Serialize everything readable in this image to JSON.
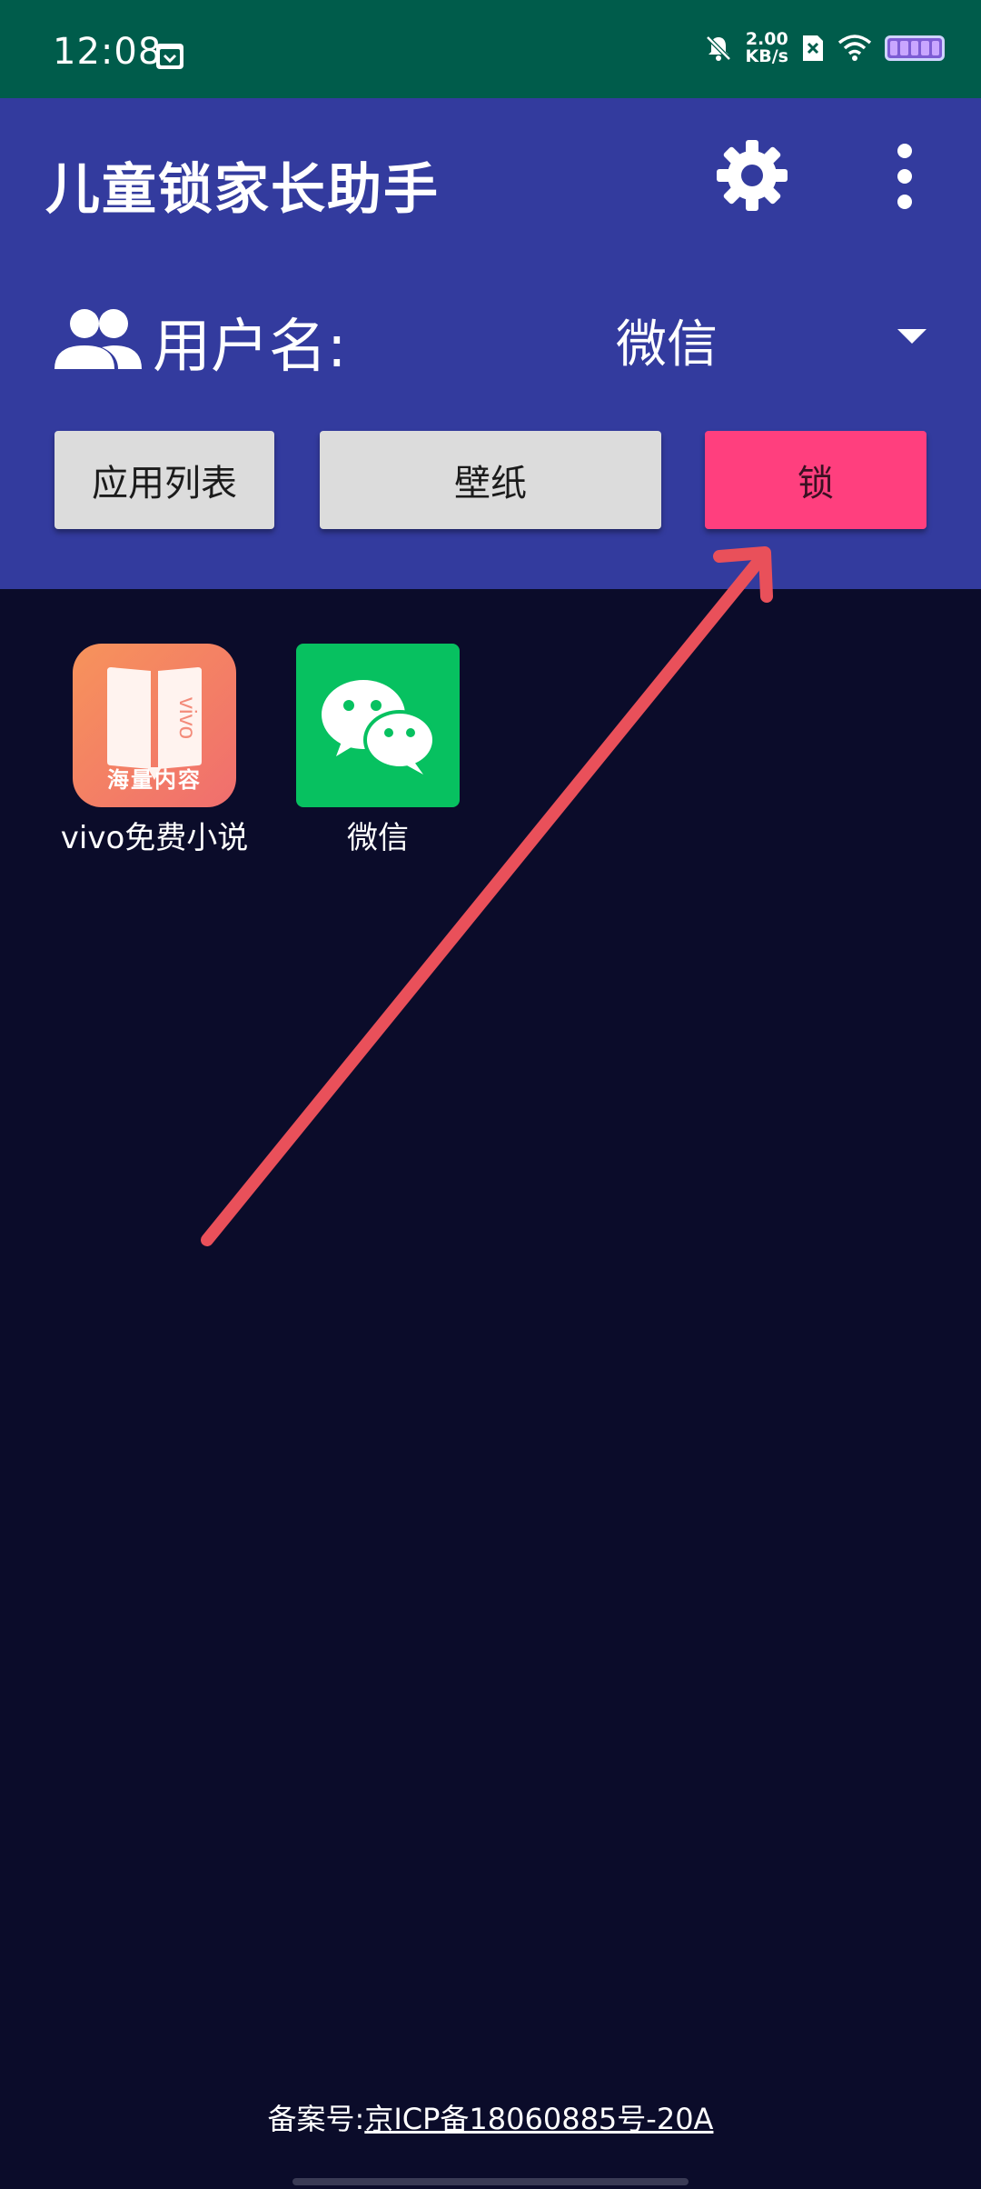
{
  "status_bar": {
    "time": "12:08",
    "net_speed_value": "2.00",
    "net_speed_unit": "KB/s",
    "icons": [
      "calendar-icon",
      "mute-icon",
      "sim-off-icon",
      "wifi-icon",
      "battery-icon"
    ]
  },
  "app_bar": {
    "title": "儿童锁家长助手",
    "settings_icon": "gear-icon",
    "more_icon": "more-vert-icon"
  },
  "user": {
    "label": "用户名:",
    "selected": "微信"
  },
  "buttons": {
    "apps": "应用列表",
    "wallpaper": "壁纸",
    "lock": "锁"
  },
  "apps": [
    {
      "name": "vivo免费小说",
      "icon_tag": "海量内容",
      "icon": "vivo-novel-icon"
    },
    {
      "name": "微信",
      "icon": "wechat-icon"
    }
  ],
  "footer": {
    "label": "备案号:",
    "icp": "京ICP备18060885号-20A"
  },
  "colors": {
    "status_bar": "#005c4b",
    "app_bar": "#333b9e",
    "background": "#0b0c2a",
    "lock_button": "#ff3f7e",
    "arrow": "#e9505a"
  }
}
